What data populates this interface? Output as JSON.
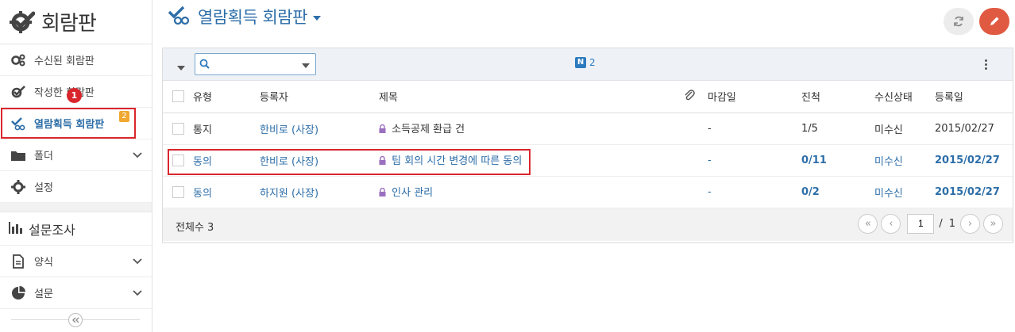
{
  "sidebar": {
    "app_title": "회람판",
    "items": [
      {
        "label": "수신된 회람판",
        "icon": "gears-icon"
      },
      {
        "label": "작성한 회람판",
        "icon": "check-gear-icon"
      },
      {
        "label": "열람획득 회람판",
        "icon": "link-gear-icon",
        "badge": "2",
        "active": true
      },
      {
        "label": "폴더",
        "icon": "folder-icon",
        "expandable": true
      },
      {
        "label": "설정",
        "icon": "gear-icon"
      }
    ],
    "survey_section": "설문조사",
    "survey_items": [
      {
        "label": "양식",
        "icon": "document-icon",
        "expandable": true
      },
      {
        "label": "설문",
        "icon": "pie-chart-icon",
        "expandable": true
      }
    ],
    "step_marker": "1"
  },
  "header": {
    "title": "열람획득 회람판"
  },
  "toolbar": {
    "search_placeholder": "",
    "new_badge": "N",
    "new_count": "2"
  },
  "table": {
    "columns": [
      "유형",
      "등록자",
      "제목",
      "마감일",
      "진척",
      "수신상태",
      "등록일"
    ],
    "rows": [
      {
        "type": "통지",
        "author": "한비로 (사장)",
        "title": "소득공제 환급 건",
        "deadline": "-",
        "progress": "1/5",
        "status": "미수신",
        "date": "2015/02/27"
      },
      {
        "type": "동의",
        "author": "한비로 (사장)",
        "title": "팀 회의 시간 변경에 따른 동의",
        "deadline": "-",
        "progress": "0/11",
        "status": "미수신",
        "date": "2015/02/27"
      },
      {
        "type": "동의",
        "author": "하지원 (사장)",
        "title": "인사 관리",
        "deadline": "-",
        "progress": "0/2",
        "status": "미수신",
        "date": "2015/02/27"
      }
    ]
  },
  "footer": {
    "total_label": "전체수 3",
    "page_current": "1",
    "page_separator": "/",
    "page_total": "1"
  },
  "colors": {
    "accent": "#2d6ea8",
    "highlight": "#d9262c",
    "badge": "#f0a830",
    "write_button": "#e05a42"
  }
}
